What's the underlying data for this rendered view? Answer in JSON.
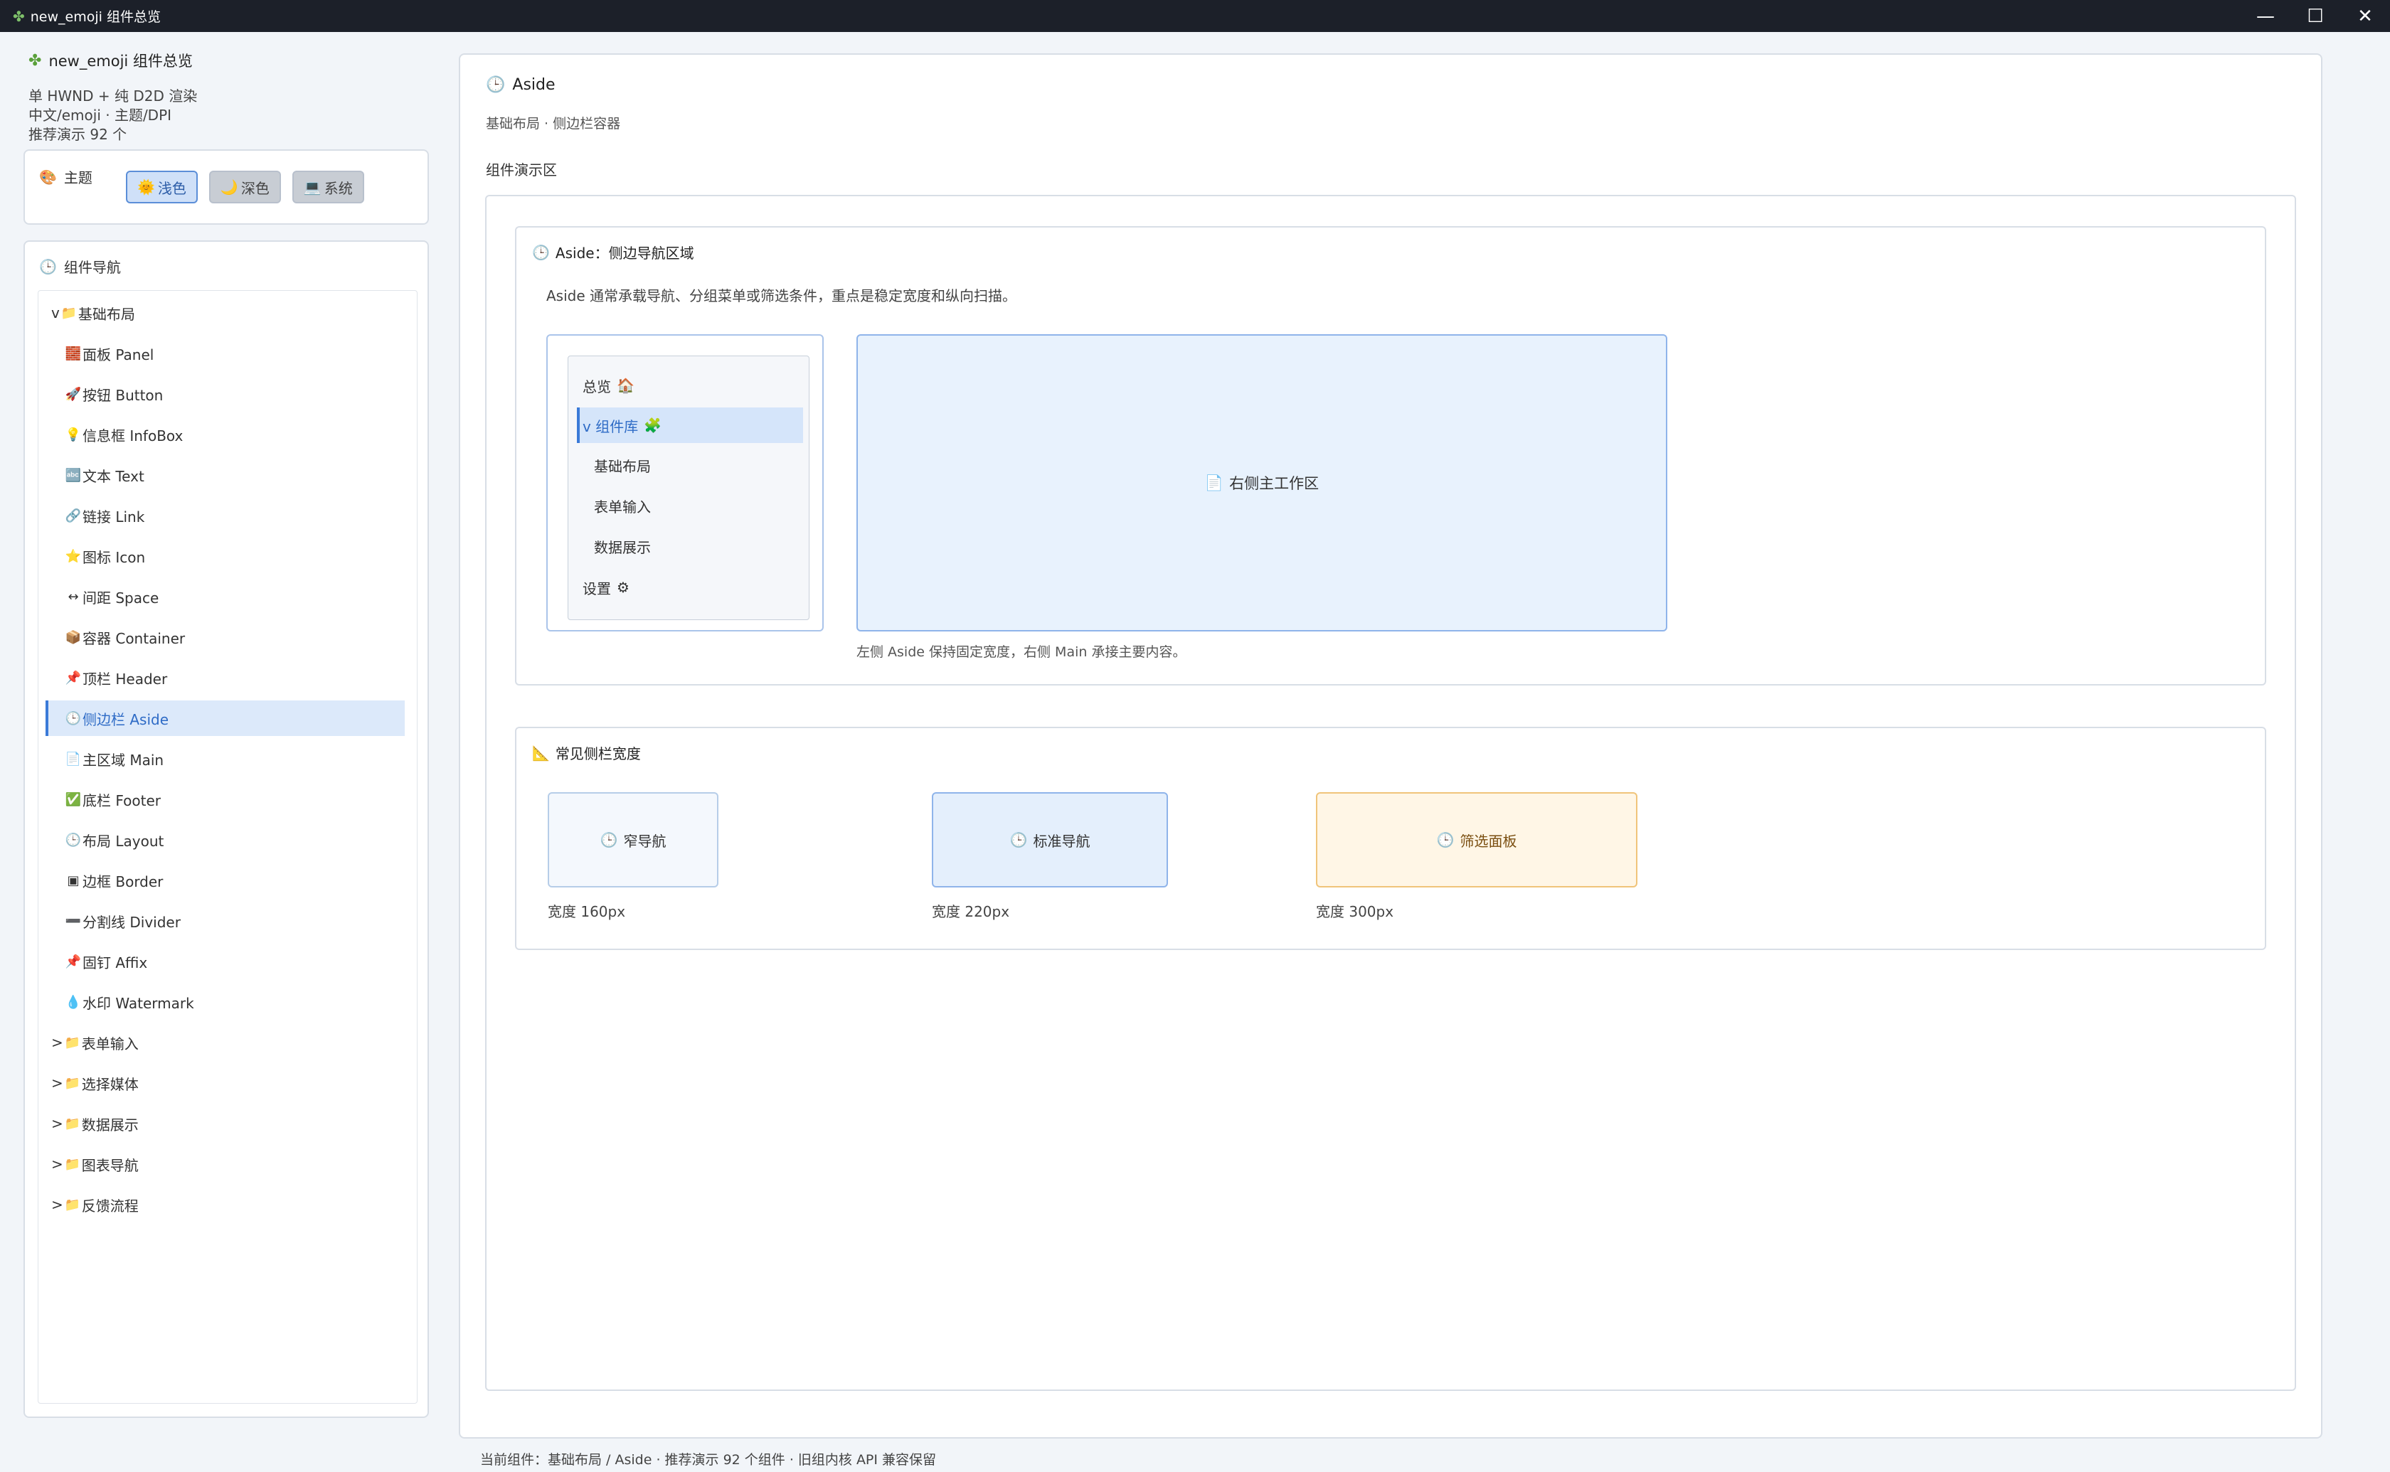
{
  "window": {
    "title": "new_emoji 组件总览",
    "minimize": "—",
    "maximize": "☐",
    "close": "✕"
  },
  "sidebar": {
    "app_name": "new_emoji 组件总览",
    "info": [
      "单 HWND + 纯 D2D 渲染",
      "中文/emoji · 主题/DPI",
      "推荐演示 92 个"
    ],
    "theme": {
      "label": "主题",
      "buttons": [
        {
          "icon": "🌞",
          "label": "浅色",
          "active": true
        },
        {
          "icon": "🌙",
          "label": "深色",
          "active": false
        },
        {
          "icon": "💻",
          "label": "系统",
          "active": false
        }
      ]
    },
    "nav": {
      "title": "组件导航",
      "items": [
        {
          "type": "folder",
          "prefix": "v",
          "label": "基础布局"
        },
        {
          "type": "child",
          "icon": "🧱",
          "label": "面板 Panel"
        },
        {
          "type": "child",
          "icon": "🚀",
          "label": "按钮 Button"
        },
        {
          "type": "child",
          "icon": "💡",
          "label": "信息框 InfoBox"
        },
        {
          "type": "child",
          "icon": "🔤",
          "label": "文本 Text"
        },
        {
          "type": "child",
          "icon": "🔗",
          "label": "链接 Link"
        },
        {
          "type": "child",
          "icon": "⭐",
          "label": "图标 Icon"
        },
        {
          "type": "child",
          "icon": "↔",
          "label": "间距 Space"
        },
        {
          "type": "child",
          "icon": "📦",
          "label": "容器 Container"
        },
        {
          "type": "child",
          "icon": "📌",
          "label": "顶栏 Header"
        },
        {
          "type": "child",
          "icon": "🕒",
          "label": "侧边栏 Aside",
          "selected": true
        },
        {
          "type": "child",
          "icon": "📄",
          "label": "主区域 Main"
        },
        {
          "type": "child",
          "icon": "✅",
          "label": "底栏 Footer"
        },
        {
          "type": "child",
          "icon": "🕒",
          "label": "布局 Layout"
        },
        {
          "type": "child",
          "icon": "▣",
          "label": "边框 Border"
        },
        {
          "type": "child",
          "icon": "➖",
          "label": "分割线 Divider"
        },
        {
          "type": "child",
          "icon": "📌",
          "label": "固钉 Affix"
        },
        {
          "type": "child",
          "icon": "💧",
          "label": "水印 Watermark"
        },
        {
          "type": "folder",
          "prefix": ">",
          "label": "表单输入"
        },
        {
          "type": "folder",
          "prefix": ">",
          "label": "选择媒体"
        },
        {
          "type": "folder",
          "prefix": ">",
          "label": "数据展示"
        },
        {
          "type": "folder",
          "prefix": ">",
          "label": "图表导航"
        },
        {
          "type": "folder",
          "prefix": ">",
          "label": "反馈流程"
        }
      ]
    }
  },
  "main": {
    "title": "Aside",
    "subtitle": "基础布局 · 侧边栏容器",
    "demo_label": "组件演示区",
    "section1": {
      "title": "Aside：侧边导航区域",
      "desc": "Aside 通常承载导航、分组菜单或筛选条件，重点是稳定宽度和纵向扫描。",
      "mini_nav": [
        {
          "label": "总览",
          "icon": "🏠",
          "kind": "top"
        },
        {
          "label": "v 组件库",
          "icon": "🧩",
          "kind": "selected"
        },
        {
          "label": "基础布局",
          "icon": "",
          "kind": "sub"
        },
        {
          "label": "表单输入",
          "icon": "",
          "kind": "sub"
        },
        {
          "label": "数据展示",
          "icon": "",
          "kind": "sub"
        },
        {
          "label": "设置",
          "icon": "⚙",
          "kind": "top"
        }
      ],
      "main_area": "右侧主工作区",
      "caption": "左侧 Aside 保持固定宽度，右侧 Main 承接主要内容。"
    },
    "section2": {
      "title": "常见侧栏宽度",
      "cards": [
        {
          "label": "窄导航",
          "width_text": "宽度 160px"
        },
        {
          "label": "标准导航",
          "width_text": "宽度 220px"
        },
        {
          "label": "筛选面板",
          "width_text": "宽度 300px"
        }
      ]
    }
  },
  "status": "当前组件：基础布局 / Aside · 推荐演示 92 个组件 · 旧组内核 API 兼容保留"
}
